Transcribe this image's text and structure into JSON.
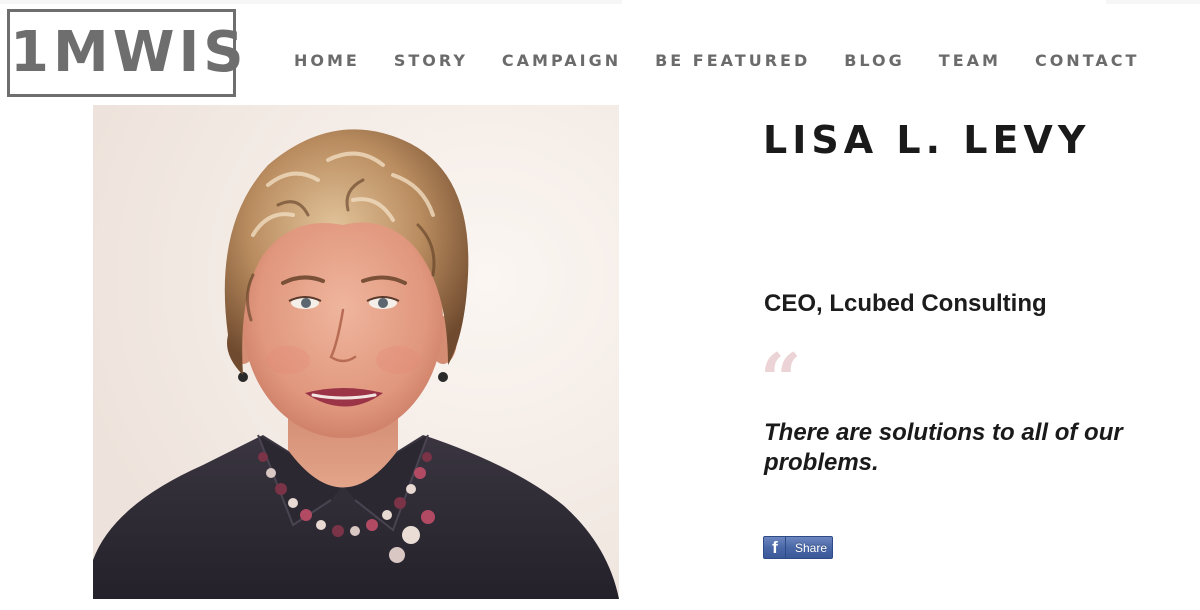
{
  "logo": {
    "text": "1MWIS"
  },
  "nav": {
    "items": [
      {
        "label": "HOME"
      },
      {
        "label": "STORY"
      },
      {
        "label": "CAMPAIGN"
      },
      {
        "label": "BE FEATURED"
      },
      {
        "label": "BLOG"
      },
      {
        "label": "TEAM"
      },
      {
        "label": "CONTACT"
      }
    ]
  },
  "profile": {
    "name": "LISA L. LEVY",
    "title": "CEO, Lcubed Consulting",
    "quote_mark": "“",
    "quote": "There are solutions to all of our problems."
  },
  "share": {
    "icon_letter": "f",
    "icon": "facebook-icon",
    "label": "Share"
  },
  "colors": {
    "nav_text": "#6b6b6b",
    "logo_border": "#6e6e6e",
    "quote_mark": "#ecd3d6",
    "facebook_blue": "#3b5998"
  }
}
